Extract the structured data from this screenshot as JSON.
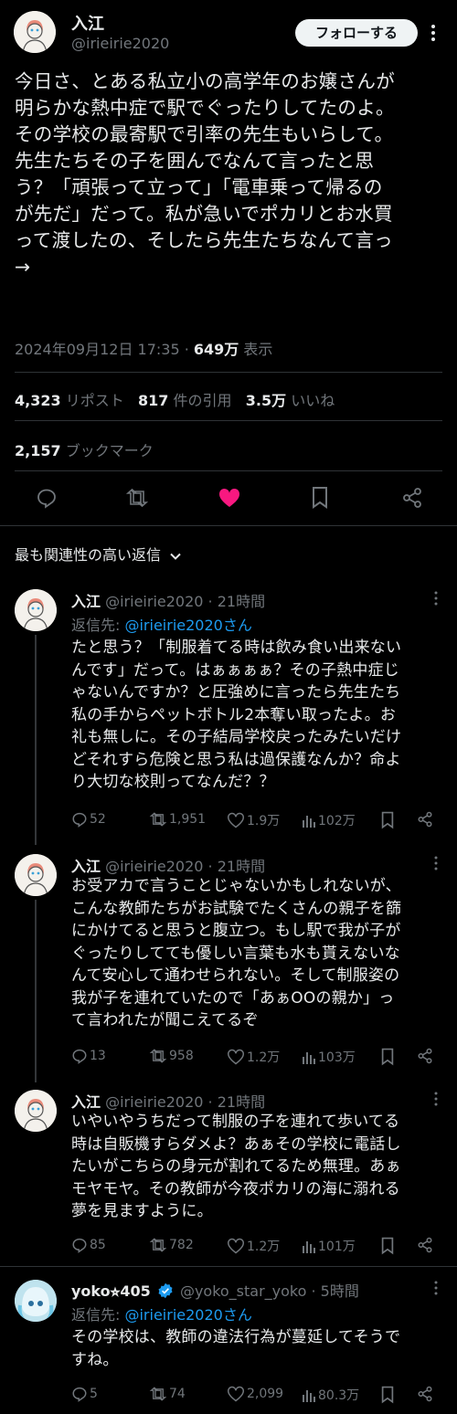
{
  "tweet": {
    "author_name": "入江",
    "author_handle": "@irieirie2020",
    "follow_label": "フォローする",
    "lines": [
      "今日さ、とある私立小の高学年のお嬢さんが",
      "明らかな熱中症で駅でぐったりしてたのよ。",
      "その学校の最寄駅で引率の先生もいらして。",
      "先生たちその子を囲んでなんて言ったと思",
      "う？「頑張って立って」「電車乗って帰るの",
      "が先だ」だって。私が急いでポカリとお水買",
      "って渡したの、そしたら先生たちなんて言っ",
      "→"
    ],
    "timestamp": "2024年09月12日 17:35 · ",
    "views_count": "649万",
    "views_label": " 表示",
    "stats": {
      "reposts_count": "4,323",
      "reposts_label": "リポスト",
      "quotes_count": "817",
      "quotes_label": "件の引用",
      "likes_count": "3.5万",
      "likes_label": "いいね",
      "bookmarks_count": "2,157",
      "bookmarks_label": "ブックマーク"
    },
    "like_color": "#f91880"
  },
  "sort_label": "最も関連性の高い返信",
  "replies": [
    {
      "name": "入江",
      "handle": "@irieirie2020 · 21時間",
      "reply_to_prefix": "返信先: ",
      "reply_to": "@irieirie2020さん",
      "lines": [
        "たと思う？「制服着てる時は飲み食い出来ない",
        "んです」だって。はぁぁぁぁ？その子熱中症じ",
        "ゃないんですか？と圧強めに言ったら先生たち",
        "私の手からペットボトル2本奪い取ったよ。お",
        "礼も無しに。その子結局学校戻ったみたいだけ",
        "どそれすら危険と思う私は過保護なんか？命よ",
        "り大切な校則ってなんだ？？"
      ],
      "replies": "52",
      "reposts": "1,951",
      "likes": "1.9万",
      "views": "102万"
    },
    {
      "name": "入江",
      "handle": "@irieirie2020 · 21時間",
      "lines": [
        "お受アカで言うことじゃないかもしれないが、",
        "こんな教師たちがお試験でたくさんの親子を篩",
        "にかけてると思うと腹立つ。もし駅で我が子が",
        "ぐったりしてても優しい言葉も水も貰えないな",
        "んて安心して通わせられない。そして制服姿の",
        "我が子を連れていたので「あぁOOの親か」っ",
        "て言われたが聞こえてるぞ"
      ],
      "replies": "13",
      "reposts": "958",
      "likes": "1.2万",
      "views": "103万"
    },
    {
      "name": "入江",
      "handle": "@irieirie2020 · 21時間",
      "lines": [
        "いやいやうちだって制服の子を連れて歩いてる",
        "時は自販機すらダメよ？あぁその学校に電話し",
        "たいがこちらの身元が割れてるため無理。あぁ",
        "モヤモヤ。その教師が今夜ポカリの海に溺れる",
        "夢を見ますように。"
      ],
      "replies": "85",
      "reposts": "782",
      "likes": "1.2万",
      "views": "101万"
    },
    {
      "name": "yoko⭐︎405",
      "handle": "@yoko_star_yoko · 5時間",
      "reply_to_prefix": "返信先: ",
      "reply_to": "@irieirie2020さん",
      "lines": [
        "その学校は、教師の違法行為が蔓延してそうで",
        "すね。"
      ],
      "replies": "5",
      "reposts": "74",
      "likes": "2,099",
      "views": "80.3万"
    }
  ],
  "icons": {
    "reply": "reply-icon",
    "repost": "repost-icon",
    "like": "like-icon",
    "bookmark": "bookmark-icon",
    "share": "share-icon",
    "views": "views-icon",
    "more": "more-icon",
    "verified": "verified-badge-icon",
    "chevron": "chevron-down-icon"
  },
  "colors": {
    "link": "#1d9bf0",
    "muted": "#71767b",
    "verified": "#1d9bf0"
  }
}
